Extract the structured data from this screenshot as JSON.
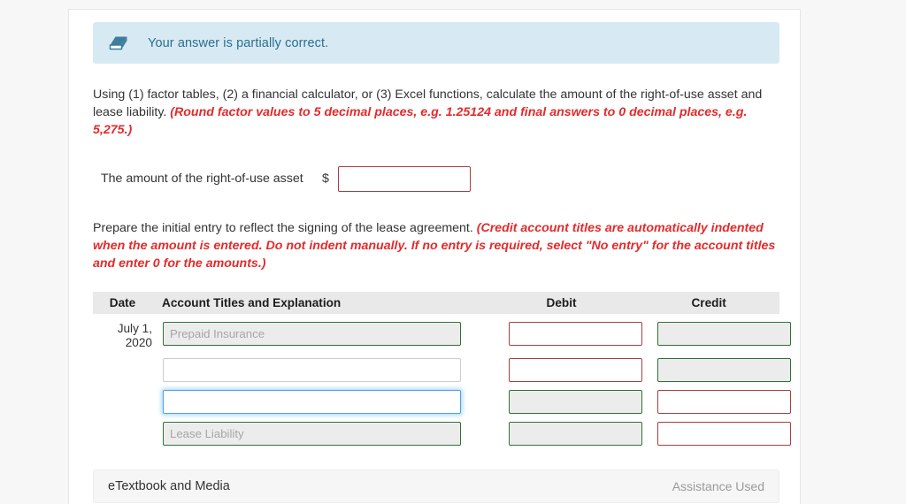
{
  "alert": {
    "icon": "eraser-icon",
    "message": "Your answer is partially correct.",
    "background_color": "#d7eaf4",
    "text_color": "#2b6e8f"
  },
  "instructions": {
    "paragraph1_main": "Using (1) factor tables, (2) a financial calculator, or (3) Excel functions, calculate the amount of the right-of-use asset and lease liability. ",
    "paragraph1_hint": "(Round factor values to 5 decimal places, e.g. 1.25124 and final answers to 0 decimal places, e.g. 5,275.)",
    "paragraph2_main": "Prepare the initial entry to reflect the signing of the lease agreement. ",
    "paragraph2_hint": "(Credit account titles are automatically indented when the amount is entered. Do not indent manually. If no entry is required, select \"No entry\" for the account titles and enter 0 for the amounts.)",
    "hint_color": "#e32b2b"
  },
  "asset_amount": {
    "label": "The amount of the right-of-use asset",
    "currency_symbol": "$",
    "value": "",
    "placeholder": ""
  },
  "journal": {
    "headers": {
      "date": "Date",
      "account": "Account Titles and Explanation",
      "debit": "Debit",
      "credit": "Credit"
    },
    "rows": [
      {
        "date_line1": "July 1,",
        "date_line2": "2020",
        "account_value": "",
        "account_placeholder": "Prepaid Insurance",
        "account_state": "state-correct",
        "debit_value": "",
        "debit_state": "state-wrong",
        "credit_value": "",
        "credit_state": "state-correct"
      },
      {
        "date_line1": "",
        "date_line2": "",
        "account_value": "",
        "account_placeholder": "",
        "account_state": "state-plain",
        "debit_value": "",
        "debit_state": "state-wrong",
        "credit_value": "",
        "credit_state": "state-correct"
      },
      {
        "date_line1": "",
        "date_line2": "",
        "account_value": "",
        "account_placeholder": "",
        "account_state": "state-focus",
        "debit_value": "",
        "debit_state": "state-correct",
        "credit_value": "",
        "credit_state": "state-wrong"
      },
      {
        "date_line1": "",
        "date_line2": "",
        "account_value": "",
        "account_placeholder": "Lease Liability",
        "account_state": "state-correct",
        "debit_value": "",
        "debit_state": "state-correct",
        "credit_value": "",
        "credit_state": "state-wrong"
      }
    ],
    "state_colors": {
      "correct_border": "#2f7135",
      "correct_fill": "#ececec",
      "incorrect_border": "#a63f3f",
      "focus_border": "#4da3e8"
    }
  },
  "footer": {
    "etextbook_label": "eTextbook and Media",
    "assistance_label": "Assistance Used"
  }
}
